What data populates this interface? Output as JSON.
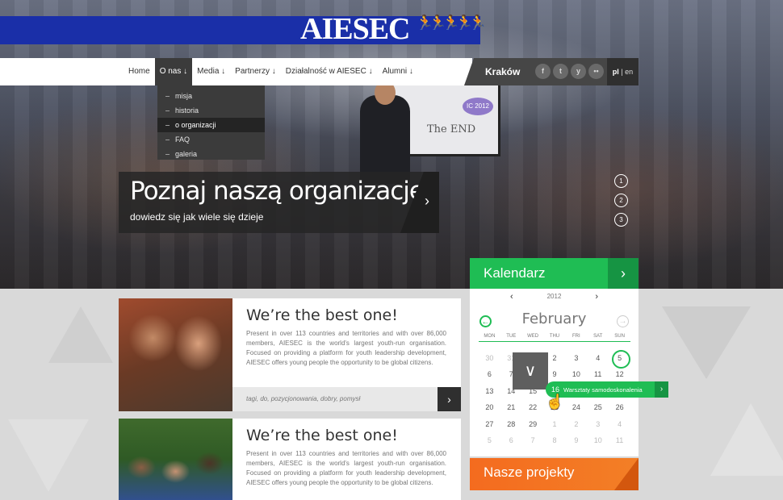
{
  "brand": {
    "logo_text": "AIESEC",
    "accent_blue": "#1a2fa8",
    "accent_green": "#1fbd54",
    "accent_orange": "#f46b1f"
  },
  "nav": {
    "items": [
      {
        "label": "Home"
      },
      {
        "label": "O nas ↓"
      },
      {
        "label": "Media ↓"
      },
      {
        "label": "Partnerzy ↓"
      },
      {
        "label": "Działalność w AIESEC ↓"
      },
      {
        "label": "Alumni ↓"
      }
    ],
    "active": "O nas ↓",
    "dropdown": [
      "misja",
      "historia",
      "o organizacji",
      "FAQ",
      "galeria"
    ],
    "dropdown_selected": "o organizacji"
  },
  "topbar": {
    "city": "Kraków",
    "social_icons": [
      "facebook-icon",
      "twitter-icon",
      "youtube-icon",
      "flickr-icon"
    ],
    "social_glyphs": [
      "f",
      "t",
      "y",
      "••"
    ],
    "lang_active": "pl",
    "lang_sep": "|",
    "lang_other": "en"
  },
  "hero": {
    "title": "Poznaj naszą organizację",
    "subtitle": "dowiedz się jak wiele się dzieje",
    "arrow": "›",
    "slides": [
      "1",
      "2",
      "3"
    ],
    "screen_badge": "IC 2012",
    "screen_text": "The END"
  },
  "articles": [
    {
      "title": "We’re the best one!",
      "body": "Present in over 113 countries and territories and with over 86,000 members, AIESEC is the world's largest youth-run organisation. Focused on providing a platform for youth leadership development, AIESEC offers young people the opportunity to be global citizens.",
      "tags": "tagi, do, pozycjonowania, dobry, pomysł",
      "arrow": "›"
    },
    {
      "title": "We’re the best one!",
      "body": "Present in over 113 countries and territories and with over 86,000 members, AIESEC is the world's largest youth-run organisation. Focused on providing a platform for youth leadership development, AIESEC offers young people the opportunity to be global citizens."
    }
  ],
  "calendar": {
    "header": "Kalendarz",
    "header_arrow": "›",
    "year": "2012",
    "year_prev": "‹",
    "year_next": "›",
    "month": "February",
    "month_prev": "←",
    "month_next": "→",
    "weekdays": [
      "MON",
      "TUE",
      "WED",
      "THU",
      "FRI",
      "SAT",
      "SUN"
    ],
    "days": [
      "30",
      "31",
      "1",
      "2",
      "3",
      "4",
      "5",
      "6",
      "7",
      "8",
      "9",
      "10",
      "11",
      "12",
      "13",
      "14",
      "15",
      "16",
      "17",
      "18",
      "19",
      "20",
      "21",
      "22",
      "23",
      "24",
      "25",
      "26",
      "27",
      "28",
      "29",
      "1",
      "2",
      "3",
      "4",
      "5",
      "6",
      "7",
      "8",
      "9",
      "10",
      "11"
    ],
    "today": "5",
    "event": {
      "day": "16",
      "title": "Warsztaty samodoskonalenia",
      "arrow": "›"
    },
    "popup_glyph": "∨",
    "cursor_glyph": "☝"
  },
  "projects": {
    "header": "Nasze projekty"
  }
}
